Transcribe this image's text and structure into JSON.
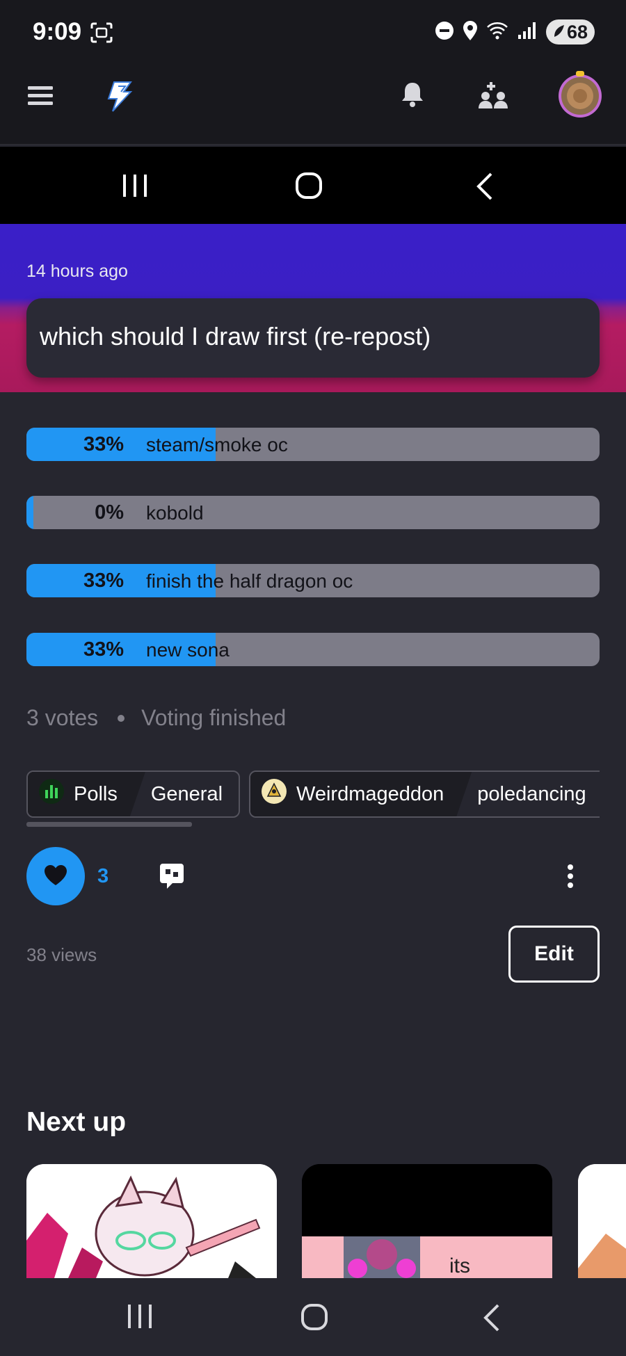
{
  "status_bar": {
    "time": "9:09",
    "battery": "68"
  },
  "post": {
    "posted_ago": "14 hours ago",
    "title": "which should I draw first (re-repost)"
  },
  "poll": {
    "options": [
      {
        "percent_label": "33%",
        "label": "steam/smoke oc",
        "fraction": 0.33
      },
      {
        "percent_label": "0%",
        "label": "kobold",
        "fraction": 0.0
      },
      {
        "percent_label": "33%",
        "label": "finish the half dragon oc",
        "fraction": 0.33
      },
      {
        "percent_label": "33%",
        "label": "new sona",
        "fraction": 0.33
      }
    ],
    "votes": "3 votes",
    "status": "Voting finished"
  },
  "tags": [
    {
      "community": "Polls",
      "category": "General"
    },
    {
      "community": "Weirdmageddon",
      "category": "poledancing"
    }
  ],
  "actions": {
    "like_count": "3",
    "views": "38 views",
    "edit_label": "Edit"
  },
  "next_up": {
    "heading": "Next up",
    "card3_text": "its"
  },
  "colors": {
    "accent": "#2196f3",
    "background": "#26262f",
    "bar_track": "#7d7c88"
  },
  "icons": {
    "menu": "hamburger-icon",
    "logo": "lightning-icon",
    "notifications": "bell-icon",
    "people": "add-people-icon",
    "like": "heart-icon",
    "comment": "comment-icon",
    "more": "more-vertical-icon"
  }
}
